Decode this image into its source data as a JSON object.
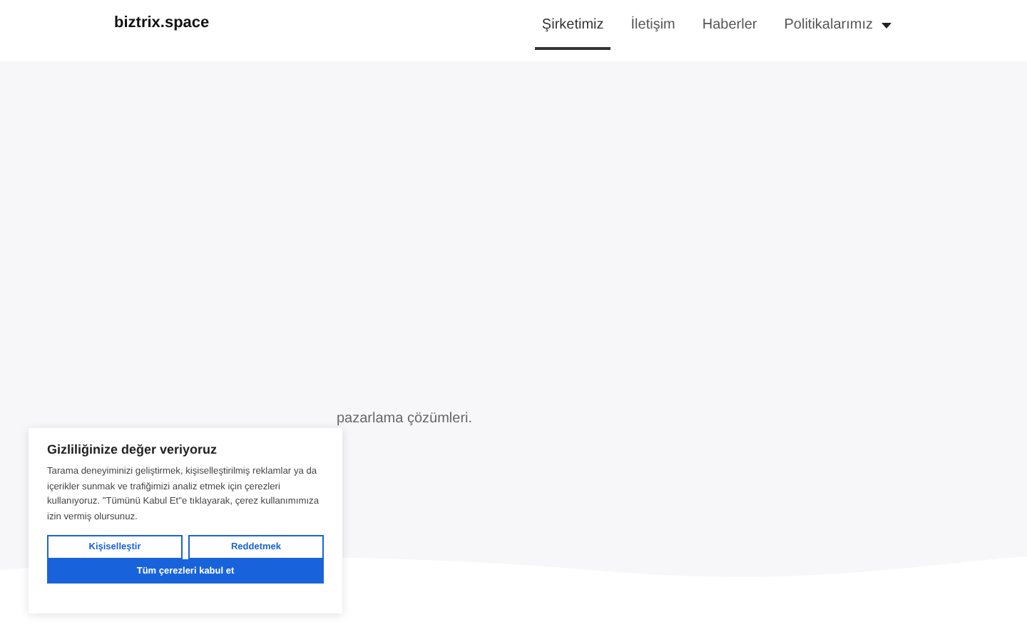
{
  "header": {
    "logo": "biztrix.space",
    "nav": [
      {
        "label": "Şirketimiz",
        "selected": true,
        "dropdown": false
      },
      {
        "label": "İletişim",
        "selected": false,
        "dropdown": false
      },
      {
        "label": "Haberler",
        "selected": false,
        "dropdown": false
      },
      {
        "label": "Politikalarımız",
        "selected": false,
        "dropdown": true
      }
    ]
  },
  "hero": {
    "tagline": "pazarlama çözümleri."
  },
  "cookie_banner": {
    "title": "Gizliliğinize değer veriyoruz",
    "text": "Tarama deneyiminizi geliştirmek, kişiselleştirilmiş reklamlar ya da içerikler sunmak ve trafiğimizi analiz etmek için çerezleri kullanıyoruz. \"Tümünü Kabul Et\"e tıklayarak, çerez kullanımımıza izin vermiş olursunuz.",
    "buttons": [
      {
        "label": "Kişiselleştir",
        "kind": "outline"
      },
      {
        "label": "Reddetmek",
        "kind": "outline"
      },
      {
        "label": "Tüm çerezleri kabul et",
        "kind": "primary"
      }
    ]
  }
}
